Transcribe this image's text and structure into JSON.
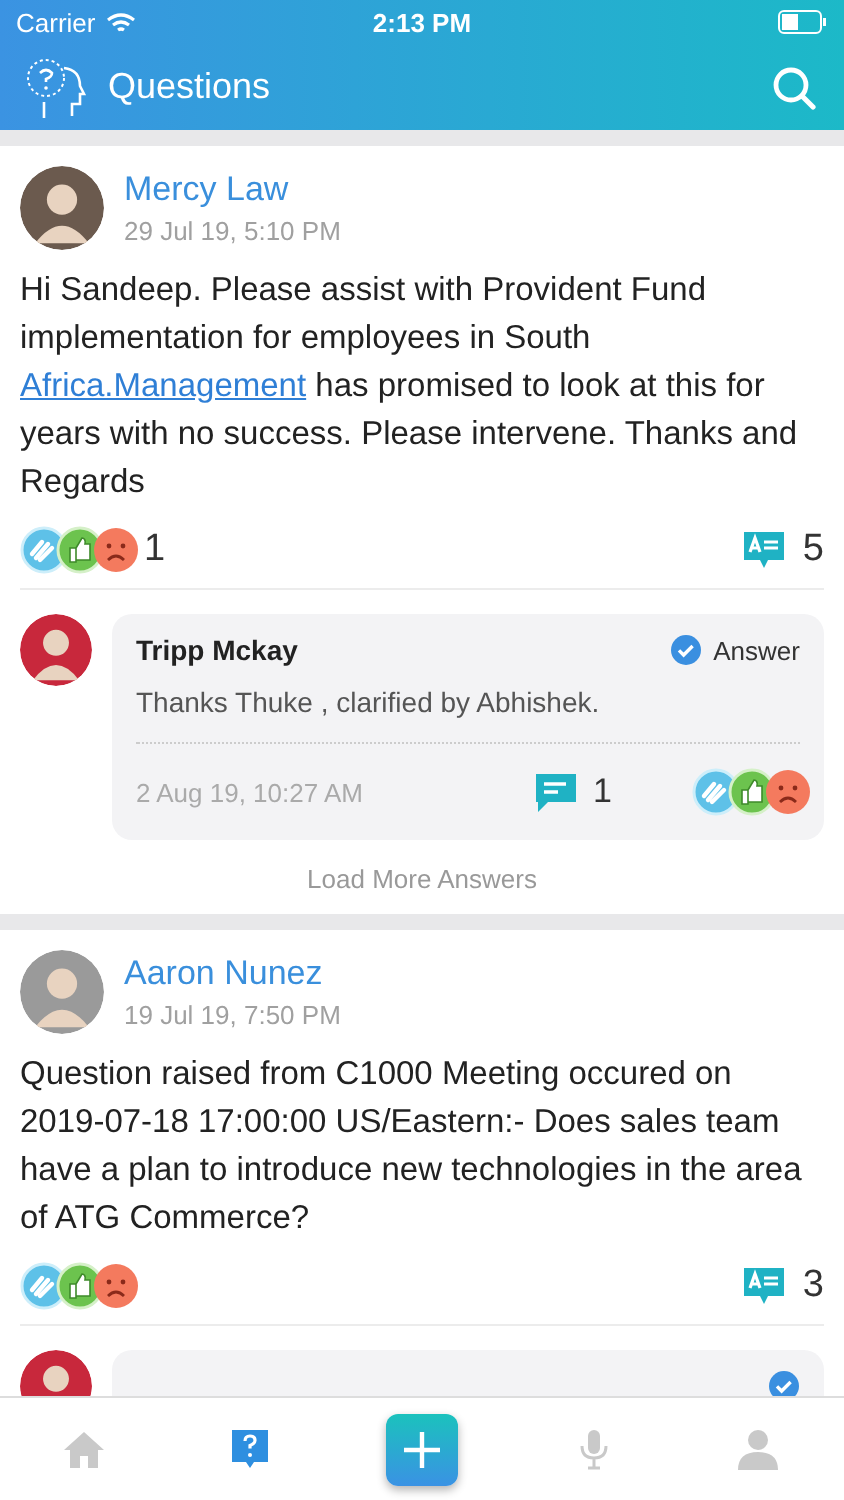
{
  "status_bar": {
    "carrier": "Carrier",
    "time": "2:13 PM"
  },
  "header": {
    "title": "Questions"
  },
  "questions": [
    {
      "author": "Mercy Law",
      "date": "29 Jul 19, 5:10 PM",
      "body": [
        {
          "text": "Hi Sandeep. Please assist with Provident Fund implementation for employees in South ",
          "link": false
        },
        {
          "text": "Africa.Management",
          "link": true
        },
        {
          "text": " has promised to look at this for years with no success. Please intervene. Thanks and Regards",
          "link": false
        }
      ],
      "reaction_count": "1",
      "answer_count": "5",
      "answers": [
        {
          "author": "Tripp Mckay",
          "verified": true,
          "badge": "Answer",
          "text": "Thanks Thuke , clarified by Abhishek.",
          "date": "2 Aug 19, 10:27 AM",
          "comment_count": "1"
        }
      ],
      "load_more": "Load More Answers"
    },
    {
      "author": "Aaron Nunez",
      "date": "19 Jul 19, 7:50 PM",
      "body": [
        {
          "text": "Question raised from C1000 Meeting occured on 2019-07-18 17:00:00 US/Eastern:- Does sales team have a plan to introduce new technologies in the area of ATG Commerce?",
          "link": false
        }
      ],
      "answer_count": "3",
      "answers": [
        {
          "verified": true
        }
      ]
    }
  ],
  "tabs": [
    {
      "kind": "home",
      "selected": false
    },
    {
      "kind": "questions",
      "selected": true
    },
    {
      "kind": "add",
      "selected": false
    },
    {
      "kind": "mic",
      "selected": false
    },
    {
      "kind": "profile",
      "selected": false
    }
  ]
}
